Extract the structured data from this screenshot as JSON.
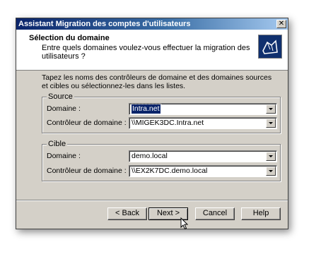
{
  "window": {
    "title": "Assistant Migration des comptes d'utilisateurs",
    "close_glyph": "✕"
  },
  "header": {
    "title": "Sélection du domaine",
    "subtitle": "Entre quels domaines voulez-vous effectuer la migration des utilisateurs ?",
    "icon": "wizard-icon"
  },
  "intro_text": "Tapez les noms des contrôleurs de domaine et des domaines sources et cibles ou sélectionnez-les dans les listes.",
  "source": {
    "legend": "Source",
    "domain_label": "Domaine :",
    "domain_value": "Intra.net",
    "dc_label": "Contrôleur de domaine :",
    "dc_value": "\\\\MIGEK3DC.Intra.net"
  },
  "target": {
    "legend": "Cible",
    "domain_label": "Domaine :",
    "domain_value": "demo.local",
    "dc_label": "Contrôleur de domaine :",
    "dc_value": "\\\\EX2K7DC.demo.local"
  },
  "buttons": {
    "back": "< Back",
    "next": "Next >",
    "cancel": "Cancel",
    "help": "Help"
  },
  "colors": {
    "titlebar": "#0a246a",
    "face": "#d4d0c8",
    "selection": "#0a246a"
  }
}
